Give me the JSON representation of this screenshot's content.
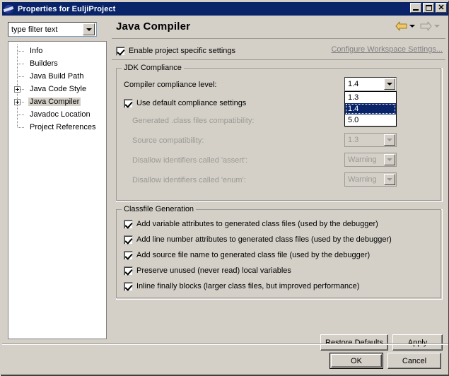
{
  "window": {
    "title": "Properties for EuljiProject",
    "icon": "eclipse-icon",
    "buttons": {
      "minimize": "Minimize",
      "maximize": "Maximize",
      "close": "Close"
    }
  },
  "sidebar": {
    "filter": {
      "value": "type filter text",
      "placeholder": "type filter text"
    },
    "items": [
      {
        "label": "Info",
        "expandable": false,
        "selected": false
      },
      {
        "label": "Builders",
        "expandable": false,
        "selected": false
      },
      {
        "label": "Java Build Path",
        "expandable": false,
        "selected": false
      },
      {
        "label": "Java Code Style",
        "expandable": true,
        "selected": false
      },
      {
        "label": "Java Compiler",
        "expandable": true,
        "selected": true
      },
      {
        "label": "Javadoc Location",
        "expandable": false,
        "selected": false
      },
      {
        "label": "Project References",
        "expandable": false,
        "selected": false
      }
    ]
  },
  "page": {
    "title": "Java Compiler",
    "nav": {
      "back": "back-arrow-icon",
      "back_menu": "back-dropdown-icon",
      "forward": "forward-arrow-icon",
      "forward_menu": "forward-dropdown-icon"
    },
    "enable_specific": {
      "label": "Enable project specific settings",
      "checked": true
    },
    "workspace_link": "Configure Workspace Settings..."
  },
  "jdk_compliance": {
    "title": "JDK Compliance",
    "compliance_level": {
      "label": "Compiler compliance level:",
      "value": "1.4",
      "enabled": true,
      "open": true,
      "options": [
        "1.3",
        "1.4",
        "5.0"
      ],
      "selected_option": "1.4"
    },
    "use_default": {
      "label": "Use default compliance settings",
      "checked": true
    },
    "generated_class": {
      "label": "Generated .class files compatibility:",
      "value": "",
      "enabled": false
    },
    "source_compat": {
      "label": "Source compatibility:",
      "value": "1.3",
      "enabled": false
    },
    "assert_ident": {
      "label": "Disallow identifiers called 'assert':",
      "value": "Warning",
      "enabled": false
    },
    "enum_ident": {
      "label": "Disallow identifiers called 'enum':",
      "value": "Warning",
      "enabled": false
    }
  },
  "classfile_generation": {
    "title": "Classfile Generation",
    "options": [
      {
        "label": "Add variable attributes to generated class files (used by the debugger)",
        "checked": true
      },
      {
        "label": "Add line number attributes to generated class files (used by the debugger)",
        "checked": true
      },
      {
        "label": "Add source file name to generated class file (used by the debugger)",
        "checked": true
      },
      {
        "label": "Preserve unused (never read) local variables",
        "checked": true
      },
      {
        "label": "Inline finally blocks (larger class files, but improved performance)",
        "checked": true
      }
    ]
  },
  "buttons": {
    "restore_defaults": "Restore Defaults",
    "apply": "Apply",
    "ok": "OK",
    "cancel": "Cancel"
  },
  "colors": {
    "titlebar": "#0a246a",
    "dialog_face": "#d4d0c8",
    "selection": "#0a246a",
    "disabled_text": "#9a9a94",
    "back_arrow": "#e8b84a"
  }
}
